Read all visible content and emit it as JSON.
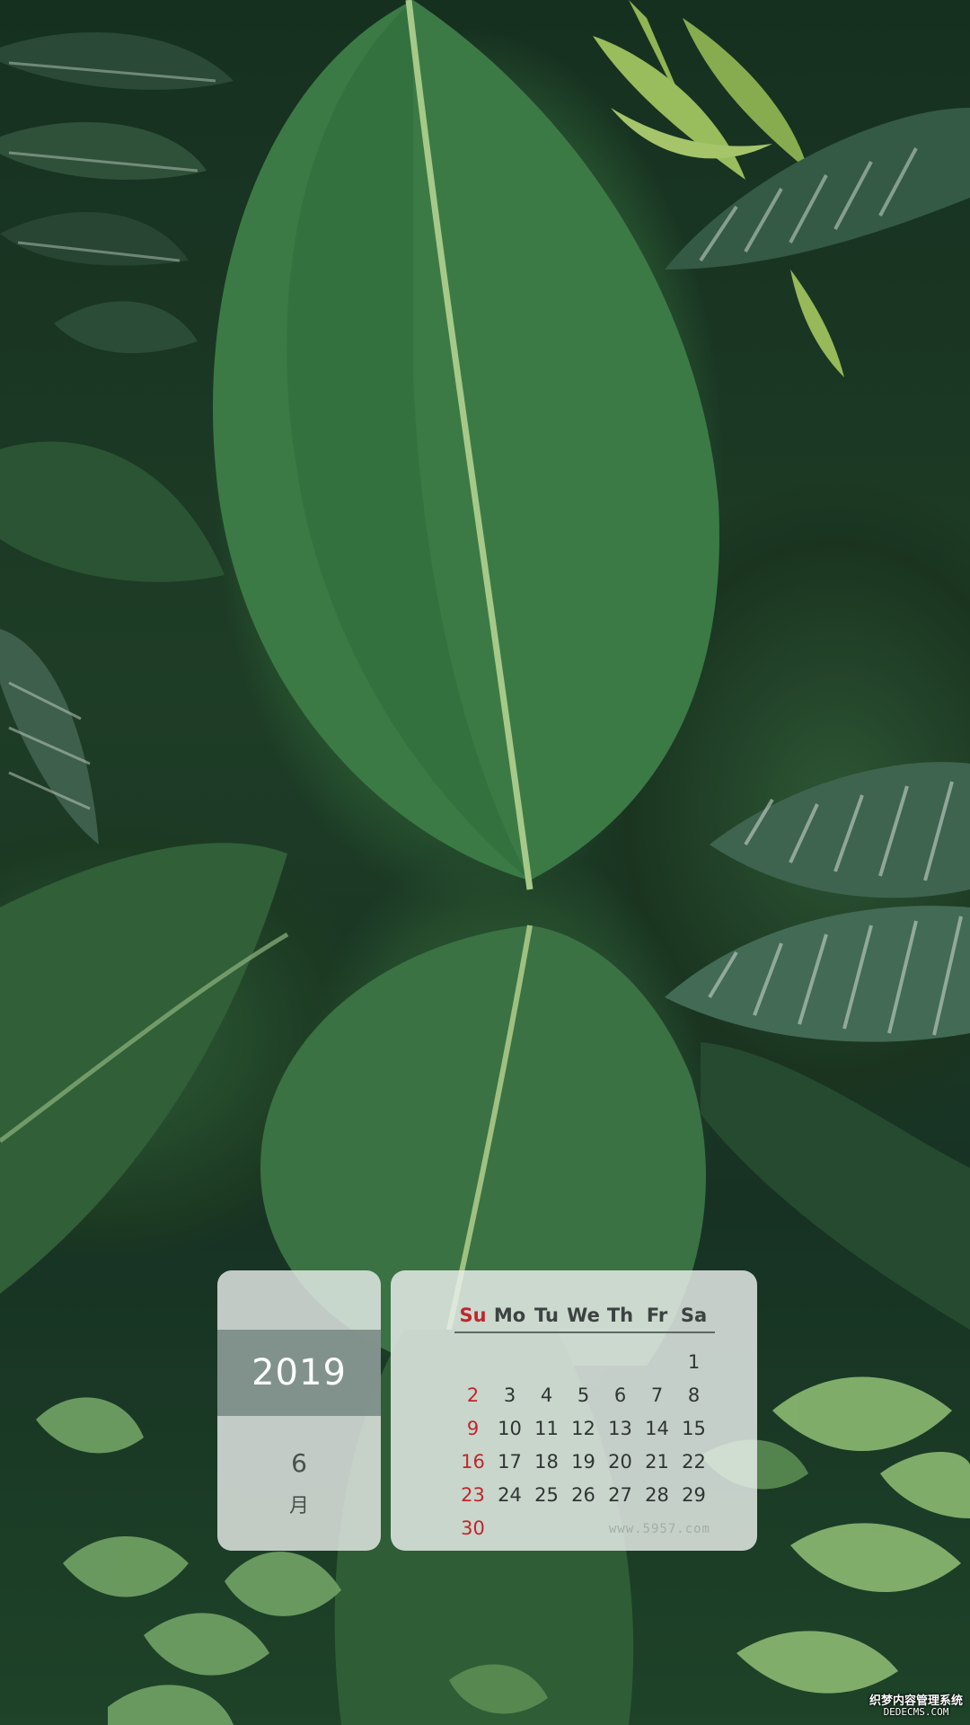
{
  "calendar": {
    "year": "2019",
    "month_number": "6",
    "month_unit": "月",
    "weekdays": [
      {
        "label": "Su",
        "sunday": true
      },
      {
        "label": "Mo",
        "sunday": false
      },
      {
        "label": "Tu",
        "sunday": false
      },
      {
        "label": "We",
        "sunday": false
      },
      {
        "label": "Th",
        "sunday": false
      },
      {
        "label": "Fr",
        "sunday": false
      },
      {
        "label": "Sa",
        "sunday": false
      }
    ],
    "weeks": [
      [
        "",
        "",
        "",
        "",
        "",
        "",
        "1"
      ],
      [
        "2",
        "3",
        "4",
        "5",
        "6",
        "7",
        "8"
      ],
      [
        "9",
        "10",
        "11",
        "12",
        "13",
        "14",
        "15"
      ],
      [
        "16",
        "17",
        "18",
        "19",
        "20",
        "21",
        "22"
      ],
      [
        "23",
        "24",
        "25",
        "26",
        "27",
        "28",
        "29"
      ],
      [
        "30",
        "",
        "",
        "",
        "",
        "",
        ""
      ]
    ],
    "watermark": "www.5957.com"
  },
  "corner_watermark": {
    "line1": "织梦内容管理系统",
    "line2": "DEDECMS.COM"
  },
  "colors": {
    "sunday": "#c0262d",
    "panel_background": "#ecf0ee",
    "year_band": "#788a84",
    "text_dark": "#2f3533"
  },
  "wallpaper": {
    "subject": "tropical-leaves-wallpaper"
  }
}
